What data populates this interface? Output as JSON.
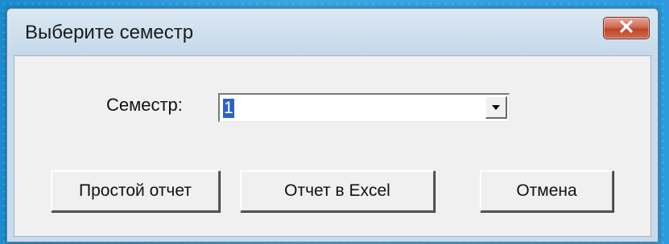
{
  "window": {
    "title": "Выберите семестр"
  },
  "form": {
    "semester_label": "Семестр:",
    "semester_value": "1"
  },
  "buttons": {
    "simple_report": "Простой отчет",
    "excel_report": "Отчет в Excel",
    "cancel": "Отмена"
  },
  "icons": {
    "close": "close-icon",
    "dropdown": "chevron-down-icon"
  },
  "colors": {
    "selection": "#2a62c7",
    "close_button": "#c0442b",
    "client_background": "#f0f0f0",
    "title_bar": "#c6d9ea"
  }
}
